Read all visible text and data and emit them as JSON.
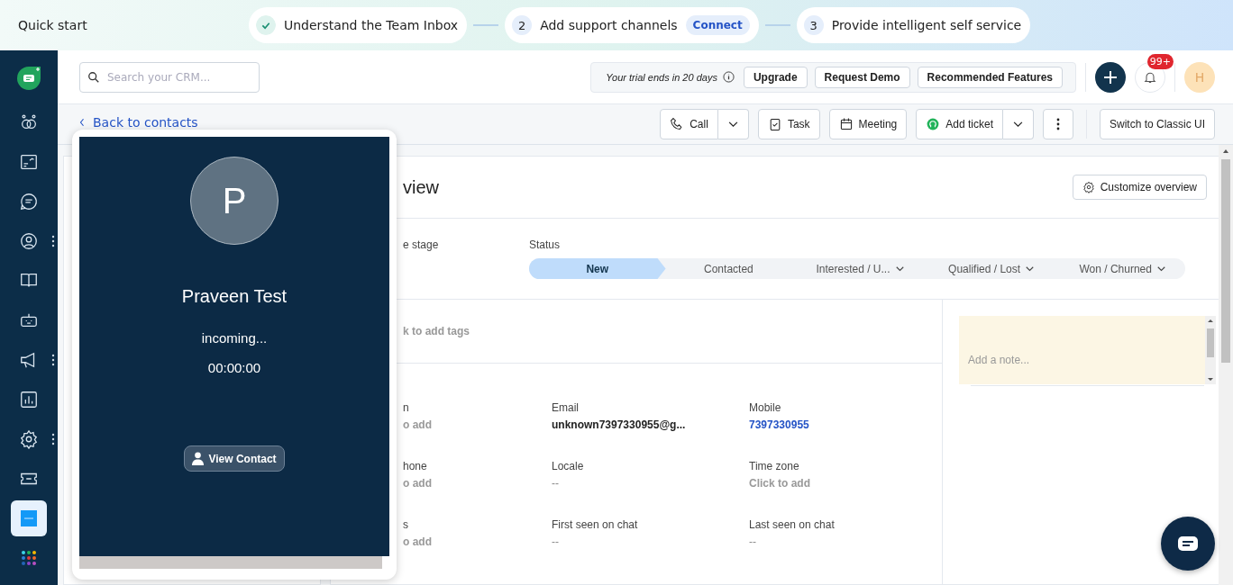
{
  "quick_start": {
    "title": "Quick start",
    "steps": [
      {
        "done": true,
        "label": "Understand the Team Inbox"
      },
      {
        "number": "2",
        "done": false,
        "label": "Add support channels",
        "badge": "Connect"
      },
      {
        "number": "3",
        "done": false,
        "label": "Provide intelligent self service"
      }
    ]
  },
  "header": {
    "search": {
      "placeholder": "Search your CRM..."
    },
    "trial": "Your trial ends in 20 days",
    "buttons": [
      "Upgrade",
      "Request Demo",
      "Recommended Features"
    ],
    "notification_count": "99+",
    "avatar": "H"
  },
  "sidebar": {
    "items": [
      {
        "menu": false,
        "selected": false
      },
      {
        "menu": false,
        "selected": false
      },
      {
        "menu": false,
        "selected": false
      },
      {
        "menu": true,
        "selected": false
      },
      {
        "menu": false,
        "selected": false
      },
      {
        "menu": false,
        "selected": false
      },
      {
        "menu": true,
        "selected": false
      },
      {
        "menu": false,
        "selected": false
      },
      {
        "menu": true,
        "selected": false
      },
      {
        "menu": false,
        "selected": false
      },
      {
        "menu": false,
        "selected": true
      },
      {
        "menu": false,
        "selected": false
      }
    ]
  },
  "toolbar": {
    "back": "Back to contacts",
    "actions": [
      {
        "label": "Call",
        "dropdown": true
      },
      {
        "label": "Task",
        "dropdown": false
      },
      {
        "label": "Meeting",
        "dropdown": false
      },
      {
        "label": "Add ticket",
        "dropdown": true
      }
    ],
    "switch": "Switch to Classic UI"
  },
  "overview": {
    "title": "view",
    "customize": "Customize overview",
    "stage_label": "e stage",
    "status_label": "Status",
    "statuses": [
      {
        "label": "New",
        "selected": true,
        "dropdown": false
      },
      {
        "label": "Contacted",
        "selected": false,
        "dropdown": false
      },
      {
        "label": "Interested / U...",
        "selected": false,
        "dropdown": true
      },
      {
        "label": "Qualified / Lost",
        "selected": false,
        "dropdown": true
      },
      {
        "label": "Won / Churned",
        "selected": false,
        "dropdown": true
      }
    ],
    "tags_hint": "k to add tags",
    "fields": [
      {
        "label": "n",
        "value": "o add",
        "kind": "empty"
      },
      {
        "label": "Email",
        "value": "unknown7397330955@g...",
        "kind": "text"
      },
      {
        "label": "Mobile",
        "value": "7397330955",
        "kind": "link"
      },
      {
        "label": "hone",
        "value": "o add",
        "kind": "empty"
      },
      {
        "label": "Locale",
        "value": "--",
        "kind": "none"
      },
      {
        "label": "Time zone",
        "value": "Click to add",
        "kind": "empty"
      },
      {
        "label": "s",
        "value": "o add",
        "kind": "empty"
      },
      {
        "label": "First seen on chat",
        "value": "--",
        "kind": "none"
      },
      {
        "label": "Last seen on chat",
        "value": "--",
        "kind": "none"
      }
    ]
  },
  "notes": {
    "placeholder": "Add a note..."
  },
  "call_popup": {
    "initial": "P",
    "name": "Praveen Test",
    "state": "incoming...",
    "timer": "00:00:00",
    "button": "View Contact"
  }
}
